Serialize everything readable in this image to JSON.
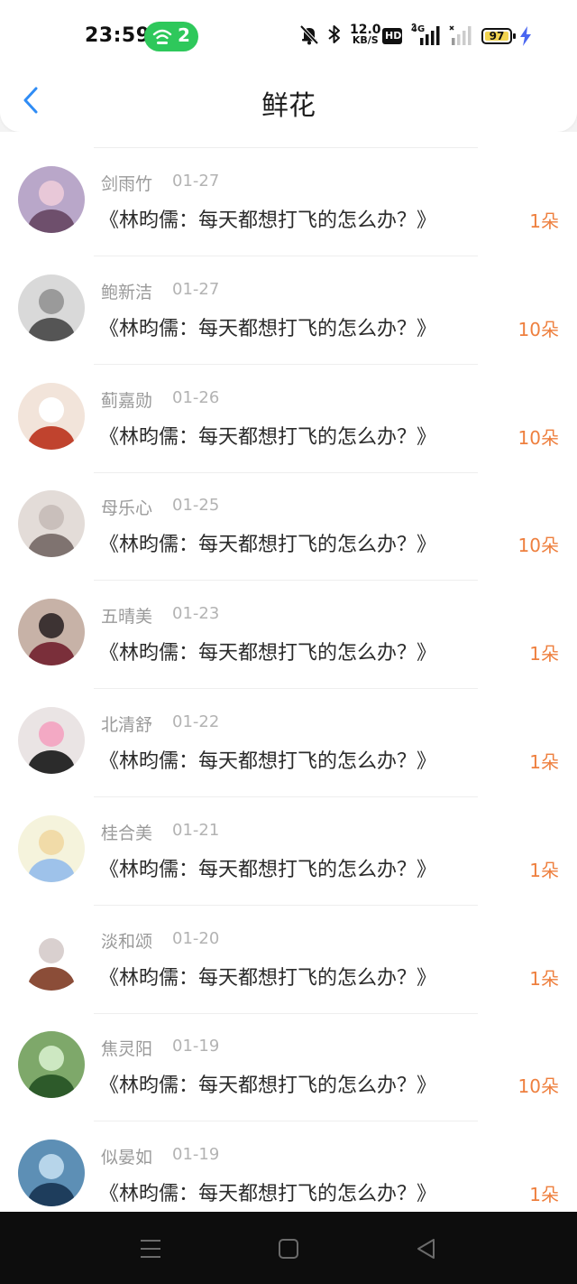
{
  "status_bar": {
    "time": "23:59",
    "hotspot_count": "2",
    "net_speed_value": "12.0",
    "net_speed_unit": "KB/S",
    "hd_label": "HD",
    "network_type": "4G",
    "battery_level": "97",
    "icons": [
      "mute-bell-icon",
      "bluetooth-icon",
      "hd-voice-icon",
      "signal-icon",
      "signal-weak-icon",
      "battery-icon",
      "charging-icon"
    ]
  },
  "header": {
    "title": "鲜花",
    "back_icon": "chevron-left-icon",
    "accent_color": "#2f8cf5"
  },
  "records": [
    {
      "name": "剑雨竹",
      "date": "01-27",
      "book": "《林昀儒：每天都想打飞的怎么办？》",
      "amount": "1朵"
    },
    {
      "name": "鲍新洁",
      "date": "01-27",
      "book": "《林昀儒：每天都想打飞的怎么办？》",
      "amount": "10朵"
    },
    {
      "name": "蓟嘉勋",
      "date": "01-26",
      "book": "《林昀儒：每天都想打飞的怎么办？》",
      "amount": "10朵"
    },
    {
      "name": "母乐心",
      "date": "01-25",
      "book": "《林昀儒：每天都想打飞的怎么办？》",
      "amount": "10朵"
    },
    {
      "name": "五晴美",
      "date": "01-23",
      "book": "《林昀儒：每天都想打飞的怎么办？》",
      "amount": "1朵"
    },
    {
      "name": "北清舒",
      "date": "01-22",
      "book": "《林昀儒：每天都想打飞的怎么办？》",
      "amount": "1朵"
    },
    {
      "name": "桂合美",
      "date": "01-21",
      "book": "《林昀儒：每天都想打飞的怎么办？》",
      "amount": "1朵"
    },
    {
      "name": "淡和颂",
      "date": "01-20",
      "book": "《林昀儒：每天都想打飞的怎么办？》",
      "amount": "1朵"
    },
    {
      "name": "焦灵阳",
      "date": "01-19",
      "book": "《林昀儒：每天都想打飞的怎么办？》",
      "amount": "10朵"
    },
    {
      "name": "似晏如",
      "date": "01-19",
      "book": "《林昀儒：每天都想打飞的怎么办？》",
      "amount": "1朵"
    }
  ],
  "amount_color": "#ee7f3e",
  "nav_bar": {
    "icons": [
      "menu-icon",
      "home-icon",
      "back-triangle-icon"
    ]
  }
}
